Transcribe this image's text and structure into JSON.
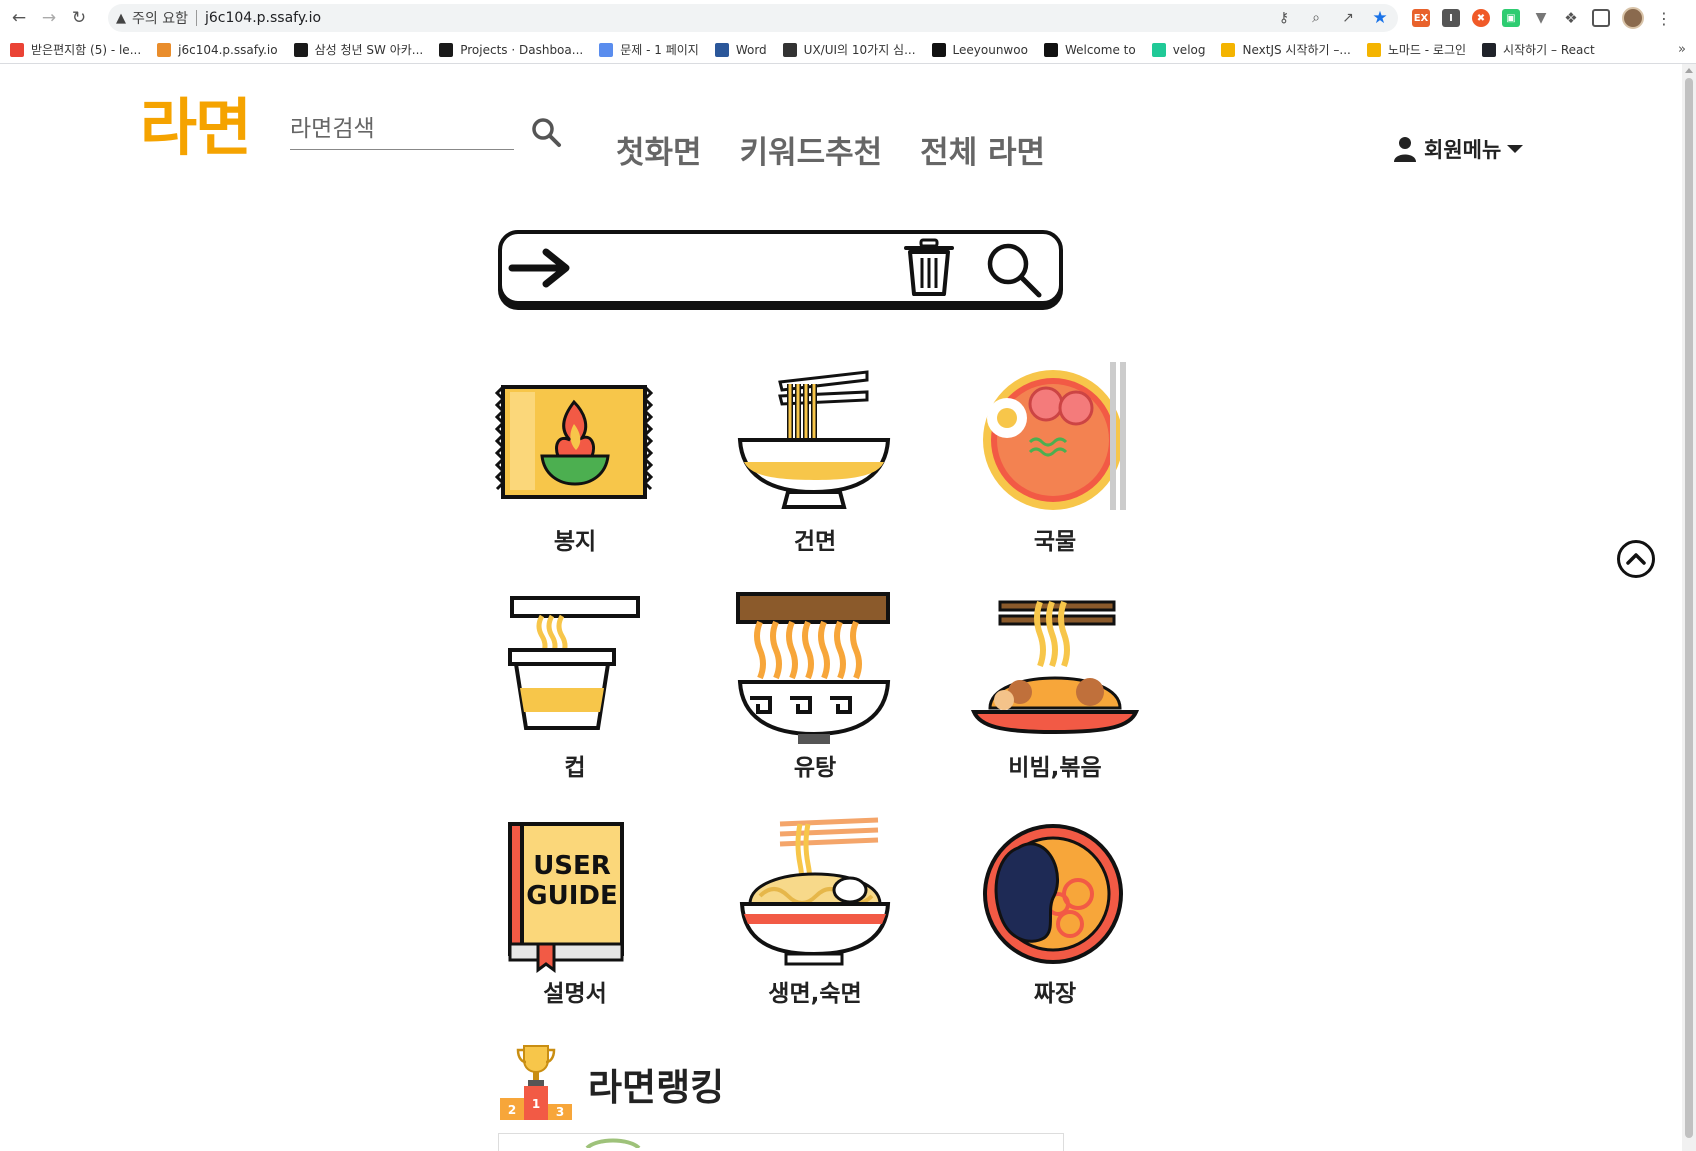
{
  "browser": {
    "security_label": "주의 요함",
    "url": "j6c104.p.ssafy.io",
    "bookmarks": [
      {
        "label": "받은편지함 (5) - le...",
        "icon": "gmail-icon",
        "color": "#ea4335"
      },
      {
        "label": "j6c104.p.ssafy.io",
        "icon": "ramen-site-icon",
        "color": "#e98d2c"
      },
      {
        "label": "삼성 청년 SW 아카...",
        "icon": "ssafy-icon",
        "color": "#1a1a1a"
      },
      {
        "label": "Projects · Dashboa...",
        "icon": "ssafy-icon",
        "color": "#1a1a1a"
      },
      {
        "label": "문제 - 1 페이지",
        "icon": "code-icon",
        "color": "#5a8dee"
      },
      {
        "label": "Word",
        "icon": "word-icon",
        "color": "#2b579a"
      },
      {
        "label": "UX/UI의 10가지 심...",
        "icon": "pen-icon",
        "color": "#333"
      },
      {
        "label": "Leeyounwoo",
        "icon": "github-icon",
        "color": "#111"
      },
      {
        "label": "Welcome to",
        "icon": "notion-icon",
        "color": "#111"
      },
      {
        "label": "velog",
        "icon": "velog-icon",
        "color": "#20c997"
      },
      {
        "label": "NextJS 시작하기 –...",
        "icon": "nomad-icon",
        "color": "#f4b400"
      },
      {
        "label": "노마드 - 로그인",
        "icon": "nomad-icon",
        "color": "#f4b400"
      },
      {
        "label": "시작하기 – React",
        "icon": "react-icon",
        "color": "#20232a"
      }
    ],
    "more": "»"
  },
  "header": {
    "logo": "라면",
    "search_placeholder": "라면검색",
    "nav": [
      "첫화면",
      "키워드추천",
      "전체 라면"
    ],
    "member_menu": "회원메뉴"
  },
  "categories": [
    "봉지",
    "건면",
    "국물",
    "컵",
    "유탕",
    "비빔,볶음",
    "설명서",
    "생면,숙면",
    "짜장"
  ],
  "ranking": {
    "title": "라면랭킹",
    "podium": [
      "2",
      "1",
      "3"
    ]
  },
  "colors": {
    "brand": "#f5a300",
    "accent_red": "#f25a45",
    "accent_yellow": "#f7c64a"
  }
}
